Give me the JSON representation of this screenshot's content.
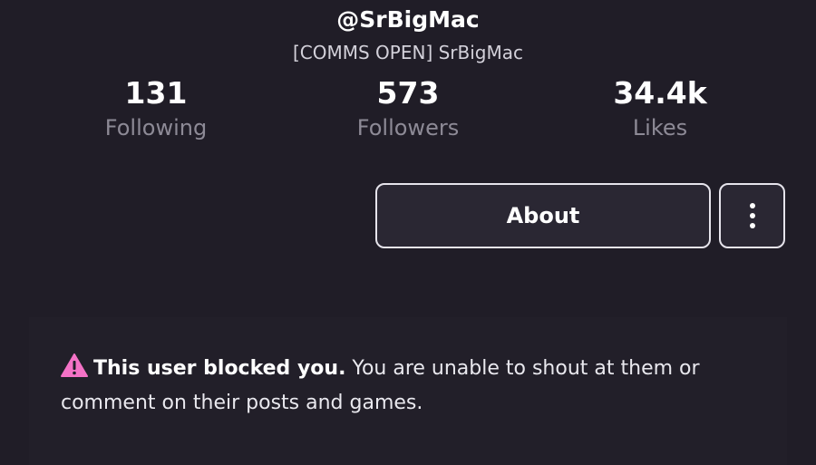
{
  "profile": {
    "username": "@SrBigMac",
    "display_name": "[COMMS OPEN] SrBigMac"
  },
  "stats": [
    {
      "value": "131",
      "label": "Following"
    },
    {
      "value": "573",
      "label": "Followers"
    },
    {
      "value": "34.4k",
      "label": "Likes"
    }
  ],
  "actions": {
    "about_label": "About",
    "more_icon": "vertical-ellipsis-icon"
  },
  "notice": {
    "icon": "warning-icon",
    "icon_color": "#f472c6",
    "title": "This user blocked you.",
    "message": " You are unable to shout at them or comment on their posts and games."
  },
  "colors": {
    "background": "#201d27",
    "button_border": "#e6e4ec",
    "muted_text": "#8d8a96"
  }
}
